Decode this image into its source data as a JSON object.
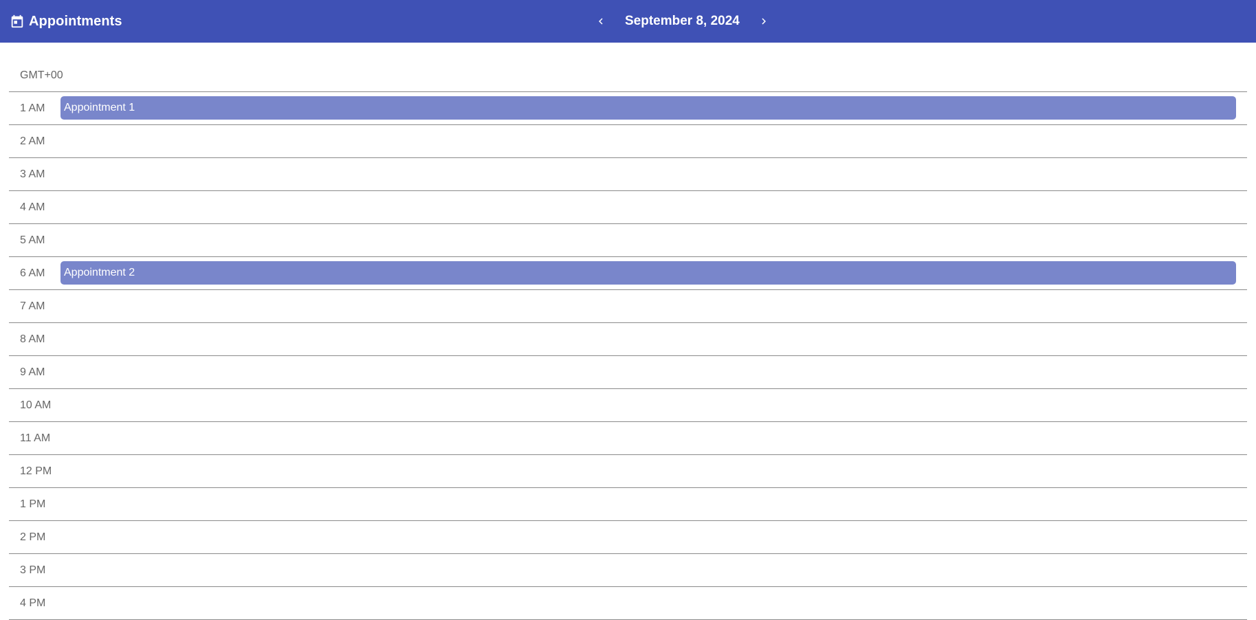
{
  "header": {
    "title": "Appointments",
    "date": "September 8, 2024",
    "icons": {
      "brand": "calendar-icon",
      "prev": "chevron-left-icon",
      "next": "chevron-right-icon"
    }
  },
  "colors": {
    "toolbar": "#3f51b5",
    "appointment": "#7986cb",
    "gridline": "#8a8a8a",
    "hour_text": "#666666"
  },
  "schedule": {
    "timezone": "GMT+00",
    "hours": [
      {
        "label": "1 AM",
        "appointment": "Appointment 1"
      },
      {
        "label": "2 AM",
        "appointment": null
      },
      {
        "label": "3 AM",
        "appointment": null
      },
      {
        "label": "4 AM",
        "appointment": null
      },
      {
        "label": "5 AM",
        "appointment": null
      },
      {
        "label": "6 AM",
        "appointment": "Appointment 2"
      },
      {
        "label": "7 AM",
        "appointment": null
      },
      {
        "label": "8 AM",
        "appointment": null
      },
      {
        "label": "9 AM",
        "appointment": null
      },
      {
        "label": "10 AM",
        "appointment": null
      },
      {
        "label": "11 AM",
        "appointment": null
      },
      {
        "label": "12 PM",
        "appointment": null
      },
      {
        "label": "1 PM",
        "appointment": null
      },
      {
        "label": "2 PM",
        "appointment": null
      },
      {
        "label": "3 PM",
        "appointment": null
      },
      {
        "label": "4 PM",
        "appointment": null
      }
    ]
  }
}
